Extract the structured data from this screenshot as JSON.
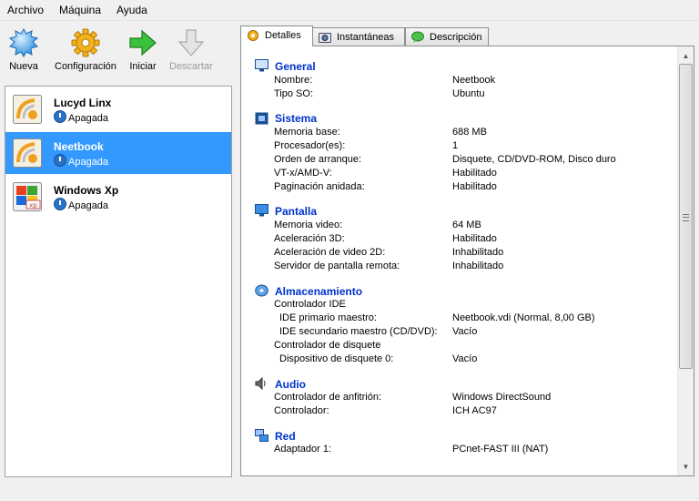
{
  "menu": [
    "Archivo",
    "Máquina",
    "Ayuda"
  ],
  "toolbar": {
    "new_label": "Nueva",
    "settings_label": "Configuración",
    "start_label": "Iniciar",
    "discard_label": "Descartar"
  },
  "vms": [
    {
      "name": "Lucyd Linx",
      "state": "Apagada",
      "os_icon": "linux-os-icon"
    },
    {
      "name": "Neetbook",
      "state": "Apagada",
      "os_icon": "linux-os-icon"
    },
    {
      "name": "Windows Xp",
      "state": "Apagada",
      "os_icon": "windows-xp-os-icon"
    }
  ],
  "tabs": [
    "Detalles",
    "Instantáneas",
    "Descripción"
  ],
  "details": {
    "general": {
      "title": "General",
      "rows": [
        {
          "label": "Nombre:",
          "value": "Neetbook"
        },
        {
          "label": "Tipo SO:",
          "value": "Ubuntu"
        }
      ]
    },
    "system": {
      "title": "Sistema",
      "rows": [
        {
          "label": "Memoria base:",
          "value": "688 MB"
        },
        {
          "label": "Procesador(es):",
          "value": "1"
        },
        {
          "label": "Orden de arranque:",
          "value": "Disquete, CD/DVD-ROM, Disco duro"
        },
        {
          "label": "VT-x/AMD-V:",
          "value": "Habilitado"
        },
        {
          "label": "Paginación anidada:",
          "value": "Habilitado"
        }
      ]
    },
    "display": {
      "title": "Pantalla",
      "rows": [
        {
          "label": "Memoria video:",
          "value": "64 MB"
        },
        {
          "label": "Aceleración 3D:",
          "value": "Habilitado"
        },
        {
          "label": "Aceleración de video 2D:",
          "value": "Inhabilitado"
        },
        {
          "label": "Servidor de pantalla remota:",
          "value": "Inhabilitado"
        }
      ]
    },
    "storage": {
      "title": "Almacenamiento",
      "rows": [
        {
          "label": "Controlador IDE",
          "value": ""
        },
        {
          "label": "IDE primario maestro:",
          "value": "Neetbook.vdi (Normal, 8,00 GB)"
        },
        {
          "label": "IDE secundario maestro (CD/DVD):",
          "value": "Vacío"
        },
        {
          "label": "Controlador de disquete",
          "value": ""
        },
        {
          "label": "Dispositivo de disquete 0:",
          "value": "Vacío"
        }
      ]
    },
    "audio": {
      "title": "Audio",
      "rows": [
        {
          "label": "Controlador de anfitrión:",
          "value": "Windows DirectSound"
        },
        {
          "label": "Controlador:",
          "value": "ICH AC97"
        }
      ]
    },
    "network": {
      "title": "Red",
      "rows": [
        {
          "label": "Adaptador 1:",
          "value": "PCnet-FAST III (NAT)"
        }
      ]
    }
  },
  "colors": {
    "selection": "#3399ff",
    "section_title": "#0033cc"
  }
}
